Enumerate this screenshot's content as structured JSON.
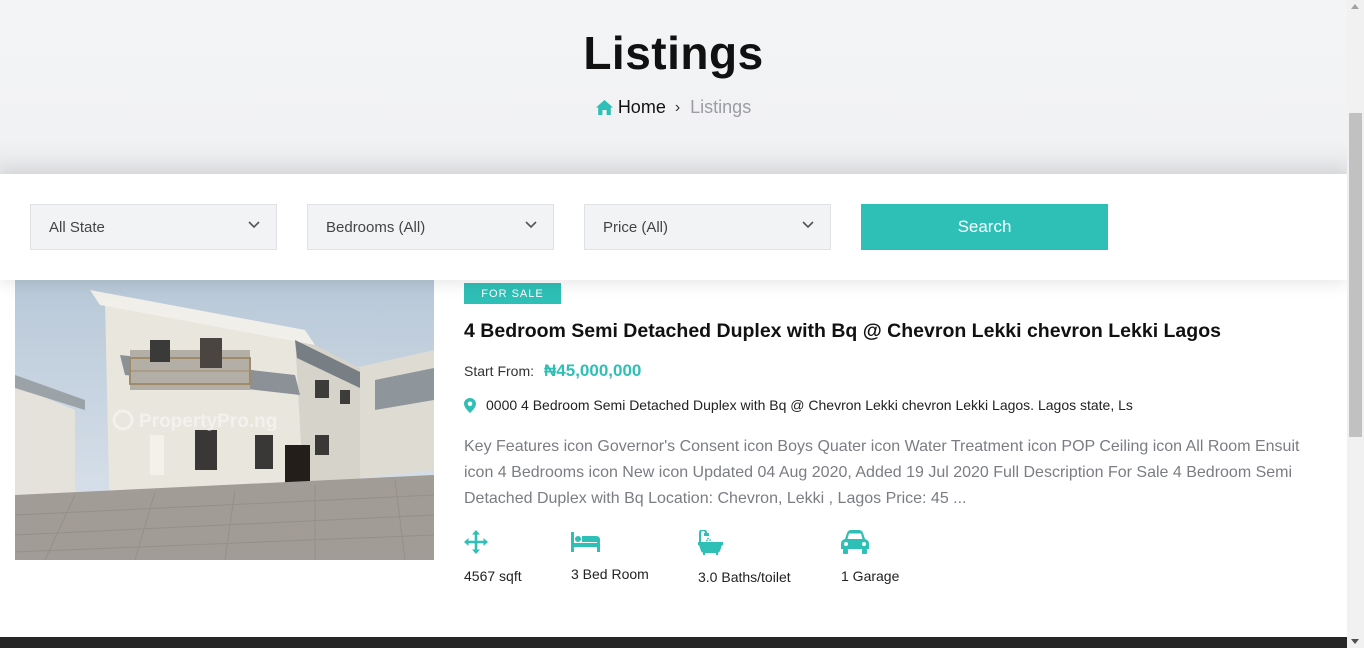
{
  "header": {
    "title": "Listings",
    "breadcrumb": {
      "home_label": "Home",
      "separator": "›",
      "current": "Listings"
    }
  },
  "filters": {
    "state_select": "All State",
    "bedrooms_select": "Bedrooms (All)",
    "price_select": "Price (All)",
    "search_label": "Search"
  },
  "listing": {
    "badge": "FOR SALE",
    "title": "4 Bedroom Semi Detached Duplex with Bq @ Chevron Lekki chevron Lekki Lagos",
    "price_label": "Start From:",
    "price": "₦45,000,000",
    "address": "0000 4 Bedroom Semi Detached Duplex with Bq @ Chevron Lekki chevron Lekki Lagos. Lagos state, Ls",
    "description": "Key Features icon Governor's Consent icon Boys Quater icon Water Treatment icon POP Ceiling icon All Room Ensuit icon 4 Bedrooms icon New icon Updated 04 Aug 2020, Added 19 Jul 2020 Full Description For Sale 4 Bedroom Semi Detached Duplex with Bq Location: Chevron, Lekki , Lagos Price: 45 ...",
    "features": [
      {
        "icon": "arrows-move-icon",
        "label": "4567 sqft"
      },
      {
        "icon": "bed-icon",
        "label": "3 Bed Room"
      },
      {
        "icon": "bathtub-icon",
        "label": "3.0 Baths/toilet"
      },
      {
        "icon": "car-icon",
        "label": "1 Garage"
      }
    ]
  },
  "colors": {
    "accent": "#2ebfb6",
    "hero_bg": "#f3f4f6",
    "muted_text": "#7a7d83"
  }
}
